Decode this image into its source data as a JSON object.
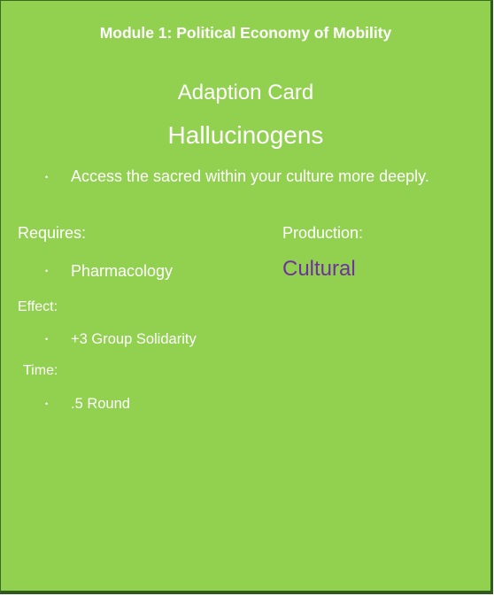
{
  "card": {
    "module_title": "Module 1: Political Economy of Mobility",
    "card_type": "Adaption Card",
    "card_name": "Hallucinogens",
    "description": "Access the sacred within your culture more deeply.",
    "requires_label": "Requires:",
    "requires": [
      "Pharmacology"
    ],
    "production_label": "Production:",
    "production_value": "Cultural",
    "effect_label": "Effect:",
    "effects": [
      "+3 Group Solidarity"
    ],
    "time_label": "Time:",
    "times": [
      ".5 Round"
    ],
    "bullet": "•"
  },
  "colors": {
    "background": "#92d050",
    "text": "#ffffff",
    "production": "#7030a0"
  }
}
